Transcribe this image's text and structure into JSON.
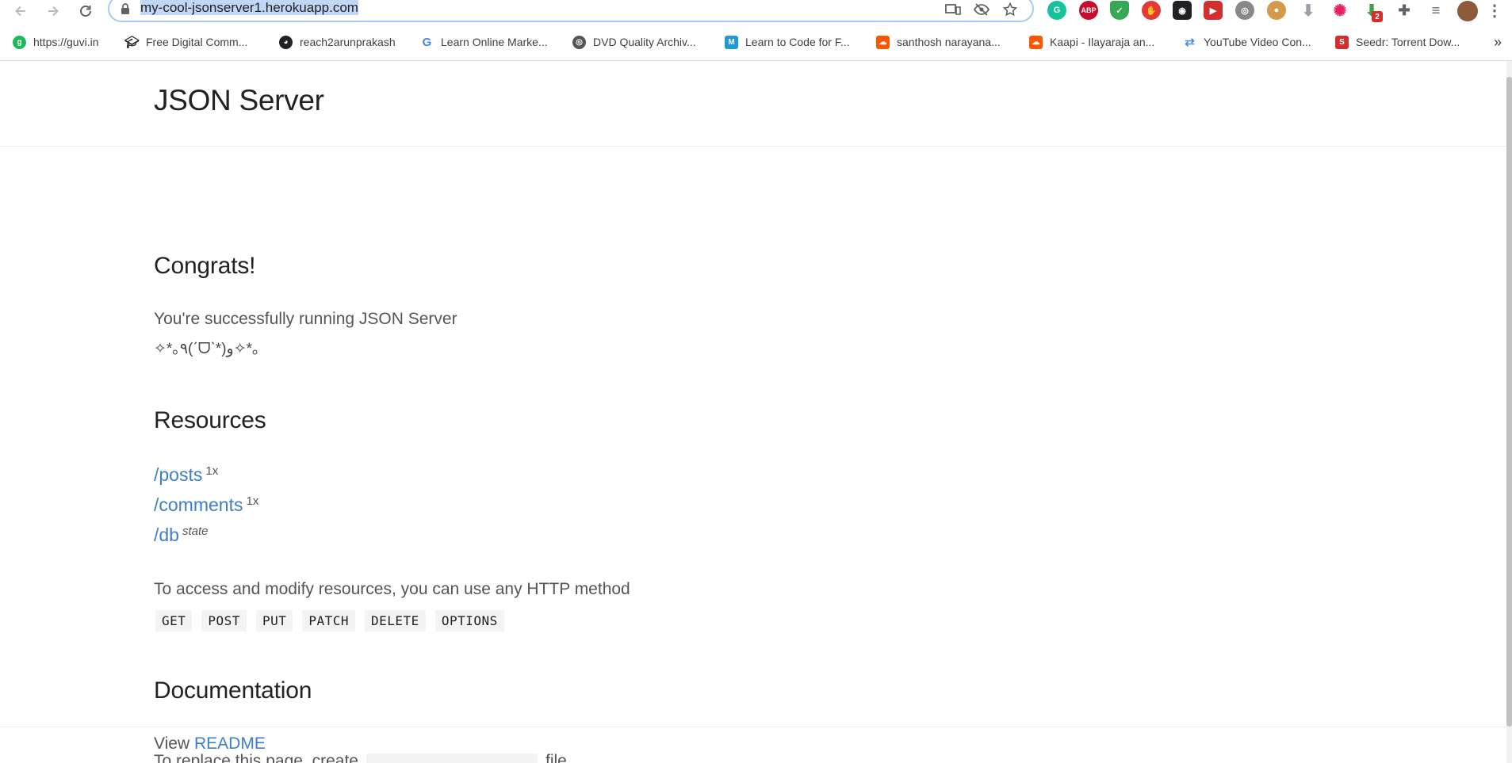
{
  "browser": {
    "url_text": "my-cool-jsonserver1.herokuapp.com",
    "back_icon": "arrow-left",
    "forward_icon": "arrow-right",
    "reload_icon": "refresh",
    "bookmarks": [
      {
        "label": "https://guvi.in",
        "icon": "guvi-icon",
        "color": "#1db954"
      },
      {
        "label": "Free Digital Comm...",
        "icon": "mortarboard-icon",
        "color": "#202124"
      },
      {
        "label": "reach2arunprakash",
        "icon": "github-icon",
        "color": "#202124"
      },
      {
        "label": "Learn Online Marke...",
        "icon": "google-icon",
        "color": "#4285f4"
      },
      {
        "label": "DVD Quality Archiv...",
        "icon": "film-reel-icon",
        "color": "#555555"
      },
      {
        "label": "Learn to Code for F...",
        "icon": "m-icon",
        "color": "#1e9bd7"
      },
      {
        "label": "santhosh narayana...",
        "icon": "soundcloud-icon",
        "color": "#ff5500"
      },
      {
        "label": "Kaapi - Ilayaraja an...",
        "icon": "soundcloud-icon",
        "color": "#ff5500"
      },
      {
        "label": "YouTube Video Con...",
        "icon": "convert-icon",
        "color": "#4a90e2"
      },
      {
        "label": "Seedr: Torrent Dow...",
        "icon": "seedr-icon",
        "color": "#d32f2f"
      }
    ],
    "more_bookmarks": "»",
    "extension_colors": {
      "grammarly": "#15c39a",
      "abp": "#c70d2c",
      "shield": "#34a853",
      "stop": "#e53935",
      "fast_forward": "#d32f2f",
      "badge": "#d32f2f"
    },
    "badge_count": "2"
  },
  "page": {
    "title": "JSON Server",
    "congrats_heading": "Congrats!",
    "congrats_text": "You're successfully running JSON Server",
    "emoticon": "✧*｡٩(ˊᗜˋ*)و✧*｡",
    "resources_heading": "Resources",
    "resources": [
      {
        "path": "/posts",
        "note": "1x"
      },
      {
        "path": "/comments",
        "note": "1x"
      },
      {
        "path": "/db",
        "note": "state"
      }
    ],
    "methods_text": "To access and modify resources, you can use any HTTP method",
    "methods": [
      "GET",
      "POST",
      "PUT",
      "PATCH",
      "DELETE",
      "OPTIONS"
    ],
    "documentation_heading": "Documentation",
    "view_label": "View",
    "readme_label": "README",
    "footer_start": "To replace this page, create",
    "footer_end": "file."
  }
}
